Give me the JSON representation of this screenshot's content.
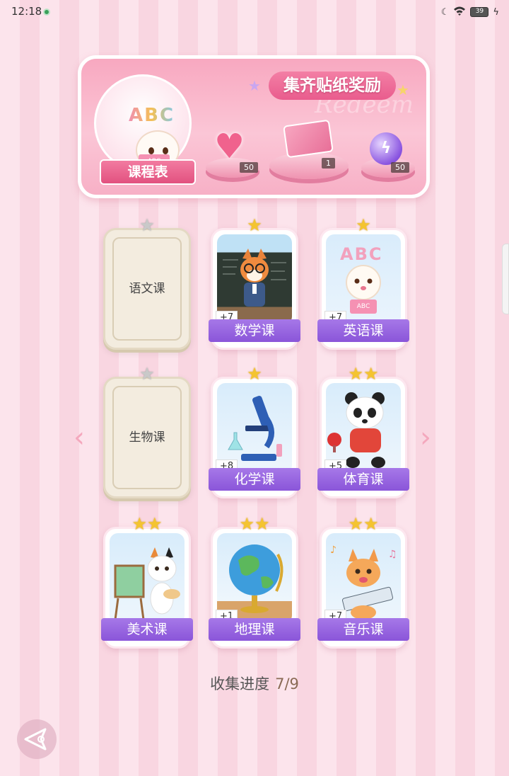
{
  "status_bar": {
    "time": "12:18",
    "battery": "39"
  },
  "banner": {
    "title": "集齐贴纸奖励",
    "watermark": "Redeem",
    "schedule_button": "课程表",
    "avatar_letters": "ABC",
    "book_label": "ABC",
    "rewards": [
      {
        "icon": "heart-gem-icon",
        "count": "50"
      },
      {
        "icon": "gift-box-icon",
        "count": "1"
      },
      {
        "icon": "purple-orb-icon",
        "count": "50"
      }
    ]
  },
  "cards": [
    {
      "name": "语文课",
      "stars": "★",
      "locked": true,
      "bonus": ""
    },
    {
      "name": "数学课",
      "stars": "★",
      "locked": false,
      "bonus": "+7",
      "art": "fox-teacher-icon"
    },
    {
      "name": "英语课",
      "stars": "★",
      "locked": false,
      "bonus": "+7",
      "art": "poodle-reading-icon",
      "art_letters": "ABC",
      "book_label": "ABC"
    },
    {
      "name": "生物课",
      "stars": "★",
      "locked": true,
      "bonus": ""
    },
    {
      "name": "化学课",
      "stars": "★",
      "locked": false,
      "bonus": "+8",
      "art": "microscope-icon"
    },
    {
      "name": "体育课",
      "stars": "★★",
      "locked": false,
      "bonus": "+5",
      "art": "panda-pingpong-icon"
    },
    {
      "name": "美术课",
      "stars": "★★",
      "locked": false,
      "bonus": "",
      "art": "cat-painter-icon"
    },
    {
      "name": "地理课",
      "stars": "★★",
      "locked": false,
      "bonus": "+1",
      "art": "globe-icon"
    },
    {
      "name": "音乐课",
      "stars": "★★",
      "locked": false,
      "bonus": "+7",
      "art": "cat-keyboard-icon"
    }
  ],
  "progress": {
    "label": "收集进度",
    "value": "7/9"
  },
  "colors": {
    "accent_pink": "#e95c8d",
    "label_purple": "#8a55d9",
    "star_gold": "#f4c430"
  }
}
